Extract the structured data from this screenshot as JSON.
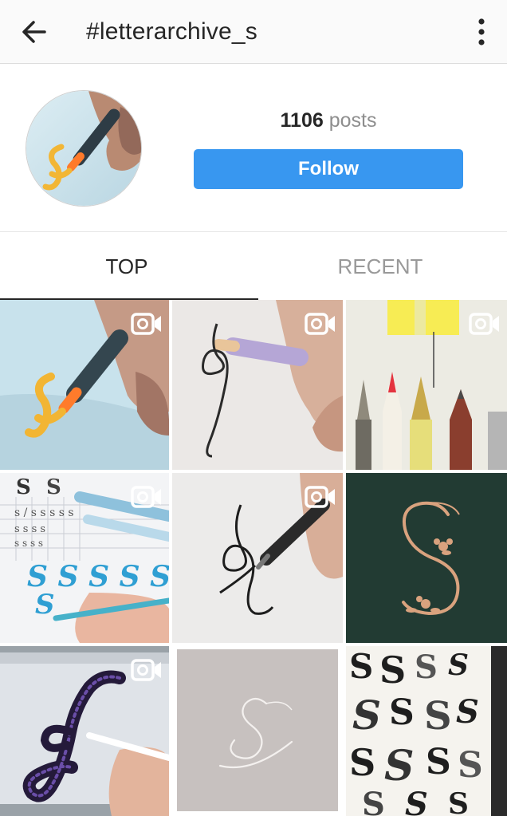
{
  "appbar": {
    "title": "#letterarchive_s",
    "back_icon": "arrow-left-icon",
    "more_icon": "more-vertical-icon"
  },
  "header": {
    "posts_count": "1106",
    "posts_label": "posts",
    "follow_label": "Follow",
    "accent_color": "#3897f0"
  },
  "tabs": [
    {
      "label": "TOP",
      "active": true
    },
    {
      "label": "RECENT",
      "active": false
    }
  ],
  "grid": {
    "tiles": [
      {
        "subject": "brush pen lettering S",
        "video": true
      },
      {
        "subject": "pencil lettering S",
        "video": true
      },
      {
        "subject": "pens and pencils",
        "video": true
      },
      {
        "subject": "S practice sheet",
        "video": true
      },
      {
        "subject": "pen flourish S",
        "video": true
      },
      {
        "subject": "gold floral S on green",
        "video": false
      },
      {
        "subject": "tablet lettering S",
        "video": true
      },
      {
        "subject": "white script S on grey",
        "video": false
      },
      {
        "subject": "sketchbook of S letters",
        "video": false
      }
    ],
    "video_icon": "video-camera-icon"
  }
}
